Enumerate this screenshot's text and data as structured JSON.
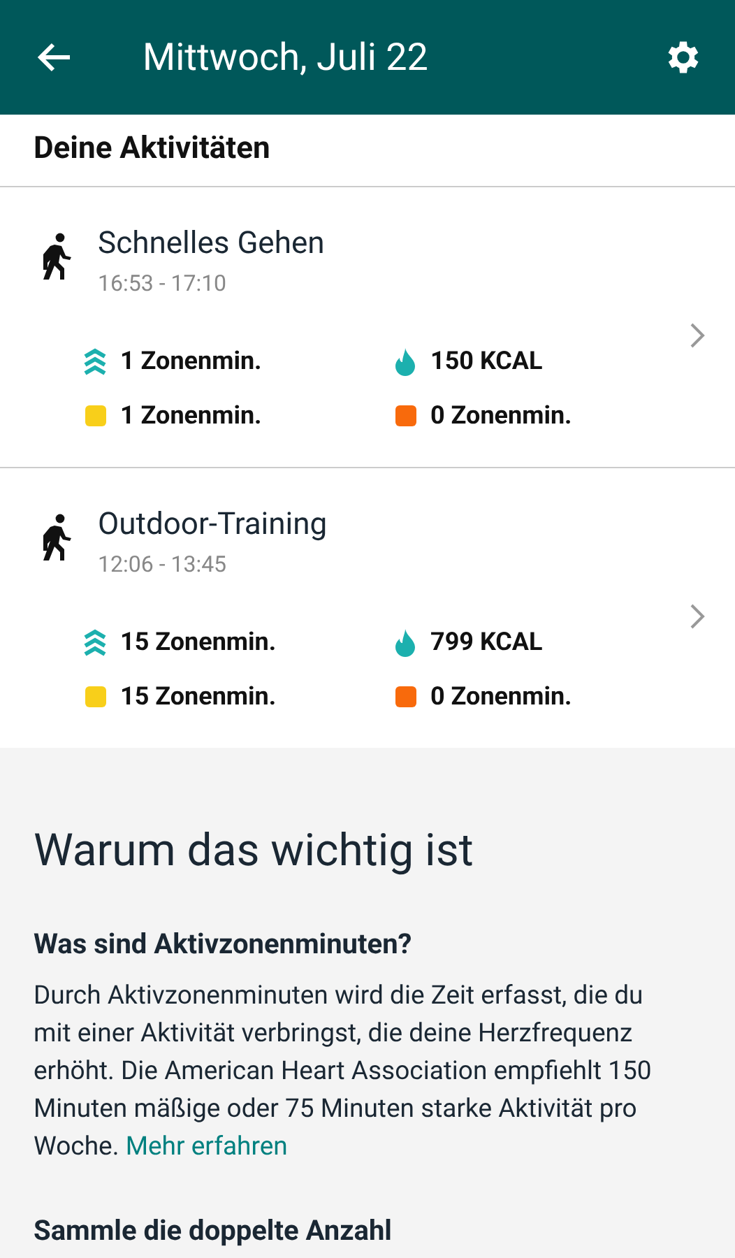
{
  "app_bar": {
    "title": "Mittwoch, Juli 22"
  },
  "section_title": "Deine Aktivitäten",
  "activities": [
    {
      "name": "Schnelles Gehen",
      "time": "16:53 - 17:10",
      "stats": [
        {
          "kind": "azm",
          "text": "1 Zonenmin."
        },
        {
          "kind": "kcal",
          "text": "150 KCAL"
        },
        {
          "kind": "swatch",
          "color": "#f8cf1a",
          "text": "1 Zonenmin."
        },
        {
          "kind": "swatch",
          "color": "#f86a0c",
          "text": "0 Zonenmin."
        }
      ]
    },
    {
      "name": "Outdoor-Training",
      "time": "12:06 - 13:45",
      "stats": [
        {
          "kind": "azm",
          "text": "15 Zonenmin."
        },
        {
          "kind": "kcal",
          "text": "799 KCAL"
        },
        {
          "kind": "swatch",
          "color": "#f8cf1a",
          "text": "15 Zonenmin."
        },
        {
          "kind": "swatch",
          "color": "#f86a0c",
          "text": "0 Zonenmin."
        }
      ]
    }
  ],
  "info": {
    "title": "Warum das wichtig ist",
    "sections": [
      {
        "heading": "Was sind Aktivzonenminuten?",
        "text": "Durch Aktivzonenminuten wird die Zeit erfasst, die du mit einer Aktivität verbringst, die deine Herzfrequenz erhöht. Die American Heart Association empfiehlt 150 Minuten mäßige oder 75 Minuten starke Aktivität pro Woche.",
        "link": "Mehr erfahren"
      },
      {
        "heading": "Sammle die doppelte Anzahl"
      }
    ]
  }
}
